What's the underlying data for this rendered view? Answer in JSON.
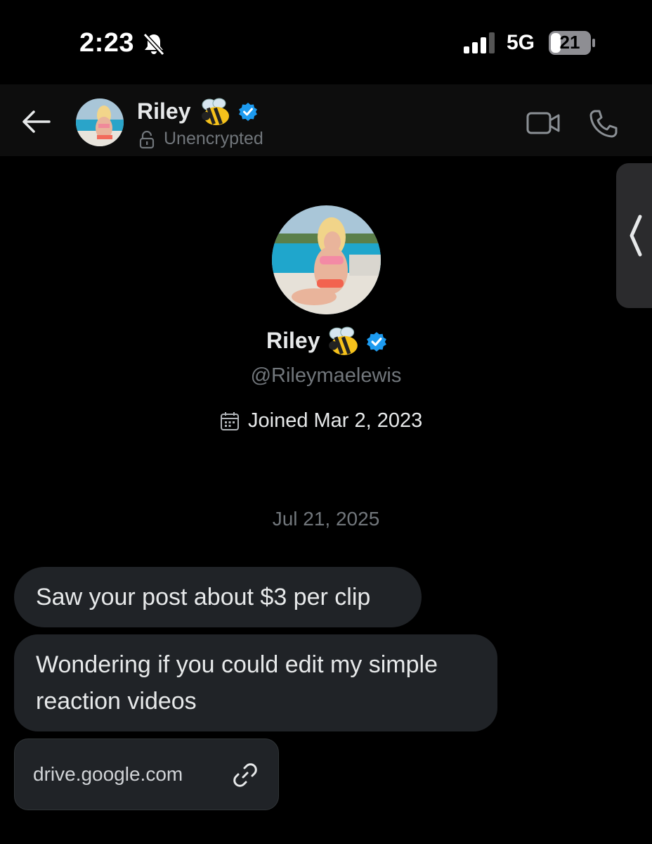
{
  "status_bar": {
    "time": "2:23",
    "network": "5G",
    "battery": "21"
  },
  "header": {
    "name": "Riley",
    "encryption_status": "Unencrypted"
  },
  "profile": {
    "name": "Riley",
    "handle": "@Rileymaelewis",
    "joined": "Joined Mar 2, 2023"
  },
  "conversation": {
    "date_separator": "Jul 21, 2025",
    "messages": [
      "Saw your post about $3 per clip",
      "Wondering if you could edit my simple reaction videos"
    ],
    "link_card": {
      "url": "drive.google.com"
    }
  },
  "icons": {
    "back": "arrow-left-icon",
    "bell": "bell-slash-icon",
    "verified": "verified-badge-icon",
    "lock": "unlock-icon",
    "video": "video-camera-icon",
    "phone": "phone-icon",
    "calendar": "calendar-icon",
    "link": "link-icon",
    "side": "chevron-left-icon"
  },
  "colors": {
    "background": "#000000",
    "bubble": "#202327",
    "verified": "#1d9bf0",
    "muted": "#71767b"
  }
}
